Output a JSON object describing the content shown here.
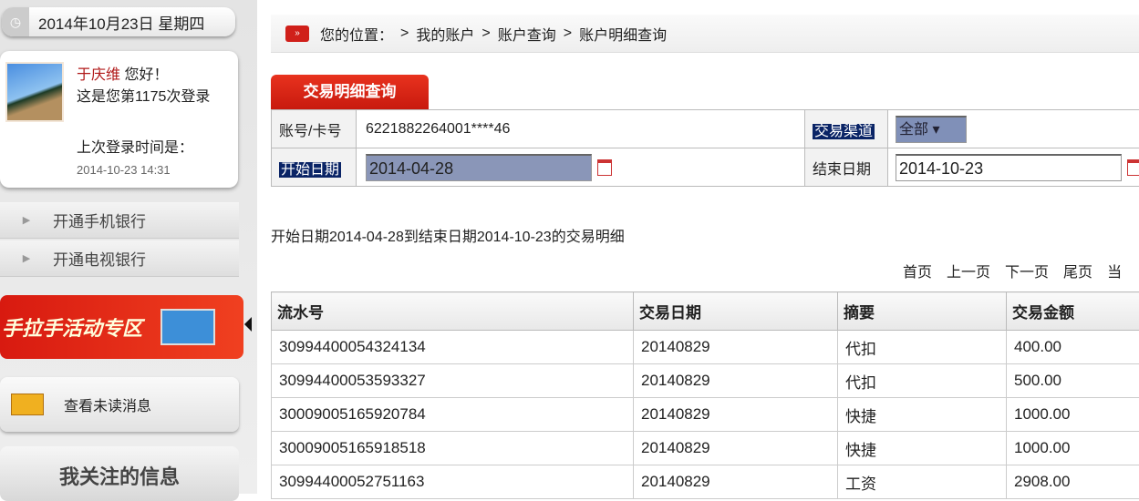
{
  "sidebar": {
    "date": "2014年10月23日 星期四",
    "user_name": "于庆维",
    "greeting": "您好！",
    "login_count_text": "这是您第1175次登录",
    "last_login_label": "上次登录时间是：",
    "last_login_time": "2014-10-23 14:31",
    "menu": [
      {
        "label": "开通手机银行"
      },
      {
        "label": "开通电视银行"
      }
    ],
    "promo": "手拉手活动专区",
    "messages": "查看未读消息",
    "focus": "我关注的信息"
  },
  "breadcrumb": {
    "prefix": "您的位置：",
    "items": [
      "我的账户",
      "账户查询",
      "账户明细查询"
    ],
    "sep": ">"
  },
  "tab": "交易明细查询",
  "form": {
    "account_label": "账号/卡号",
    "account_value": "6221882264001****46",
    "channel_label": "交易渠道",
    "channel_value": "全部",
    "start_label": "开始日期",
    "start_value": "2014-04-28",
    "end_label": "结束日期",
    "end_value": "2014-10-23"
  },
  "summary": "开始日期2014-04-28到结束日期2014-10-23的交易明细",
  "pager": [
    "首页",
    "上一页",
    "下一页",
    "尾页",
    "当"
  ],
  "table": {
    "headers": [
      "流水号",
      "交易日期",
      "摘要",
      "交易金额"
    ],
    "rows": [
      [
        "30994400054324134",
        "20140829",
        "代扣",
        "400.00"
      ],
      [
        "30994400053593327",
        "20140829",
        "代扣",
        "500.00"
      ],
      [
        "30009005165920784",
        "20140829",
        "快捷",
        "1000.00"
      ],
      [
        "30009005165918518",
        "20140829",
        "快捷",
        "1000.00"
      ],
      [
        "30994400052751163",
        "20140829",
        "工资",
        "2908.00"
      ]
    ]
  }
}
